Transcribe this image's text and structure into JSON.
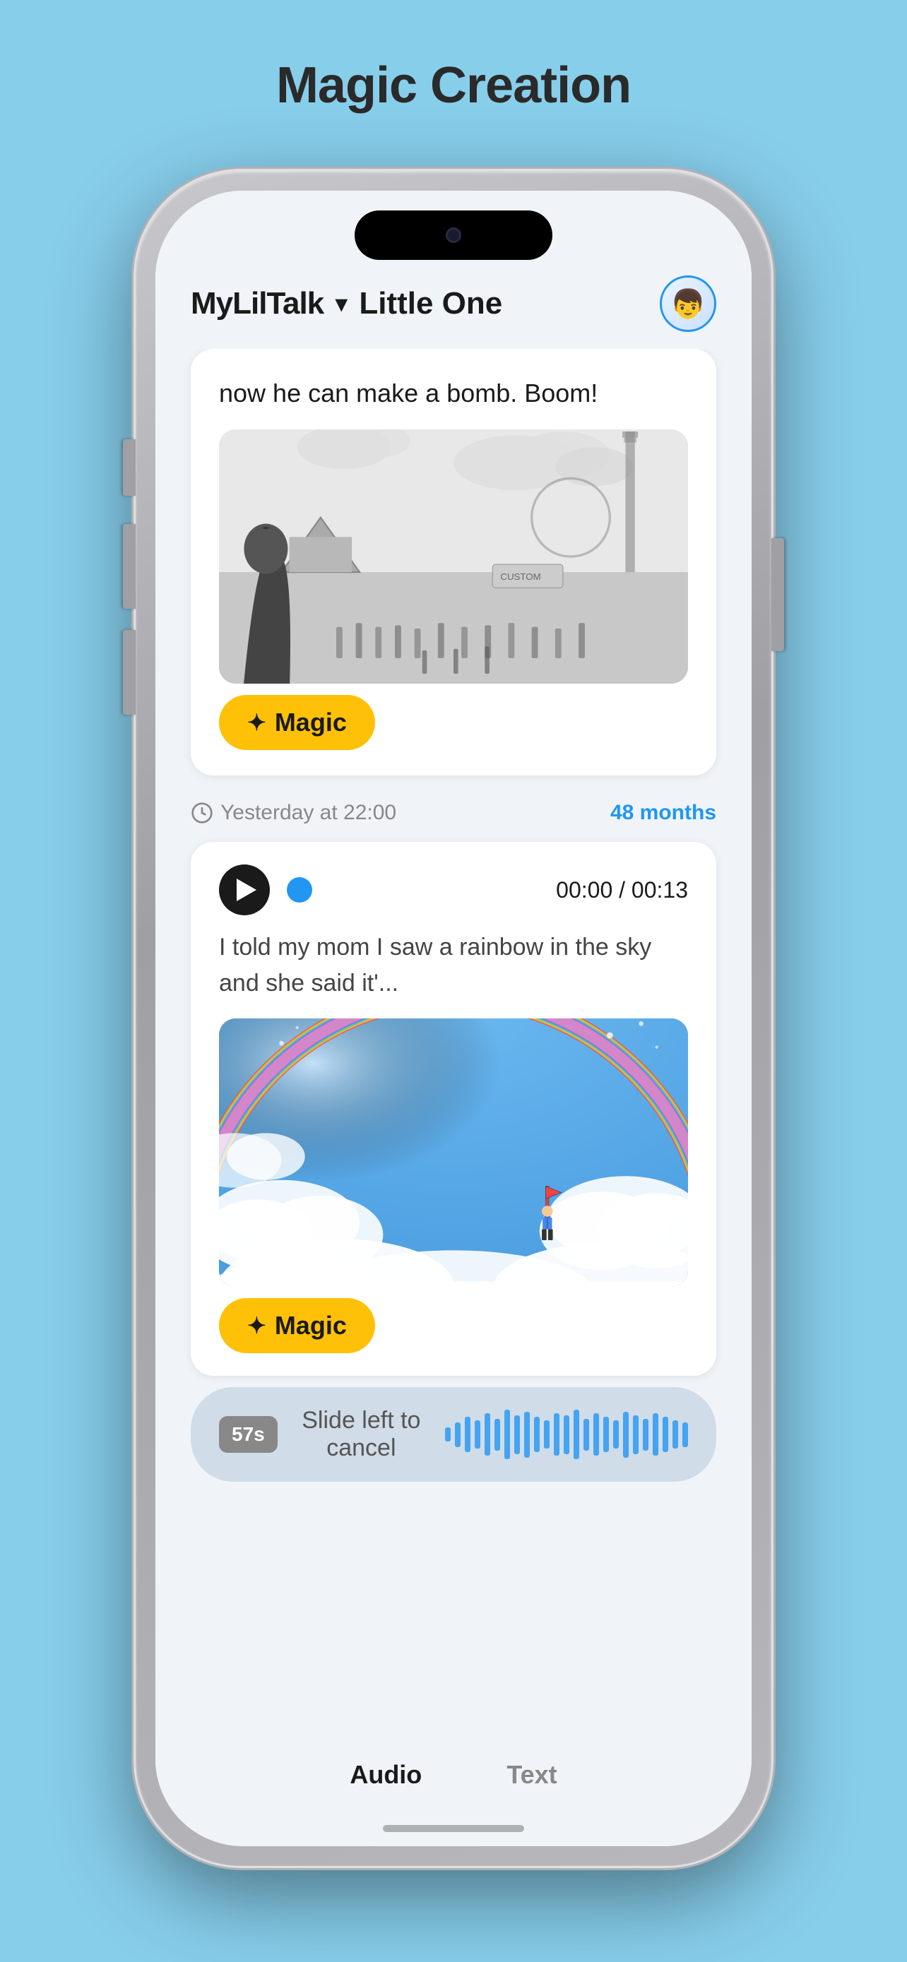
{
  "page": {
    "title": "Magic Creation",
    "background_color": "#87CEEB"
  },
  "header": {
    "app_name": "MyLilTalk",
    "child_name": "Little One",
    "chevron": "▾"
  },
  "messages": [
    {
      "id": "msg1",
      "text": "now he can make a bomb. Boom!",
      "has_image": true,
      "magic_button_label": "Magic",
      "magic_stars": "✦"
    },
    {
      "id": "msg2",
      "timestamp": "Yesterday at 22:00",
      "age_badge": "48 months",
      "audio_time": "00:00 / 00:13",
      "transcript": "I told my mom I saw a rainbow in the sky and she said it'...",
      "has_image": true,
      "magic_button_label": "Magic",
      "magic_stars": "✦"
    }
  ],
  "recording": {
    "timer": "57s",
    "slide_label": "Slide left to cancel"
  },
  "tabs": [
    {
      "label": "Audio",
      "active": true
    },
    {
      "label": "Text",
      "active": false
    }
  ],
  "wave_bars": [
    20,
    35,
    50,
    40,
    60,
    45,
    70,
    55,
    65,
    50,
    40,
    60,
    55,
    70,
    45,
    60,
    50,
    40,
    65,
    55,
    45,
    60,
    50,
    40,
    35
  ]
}
